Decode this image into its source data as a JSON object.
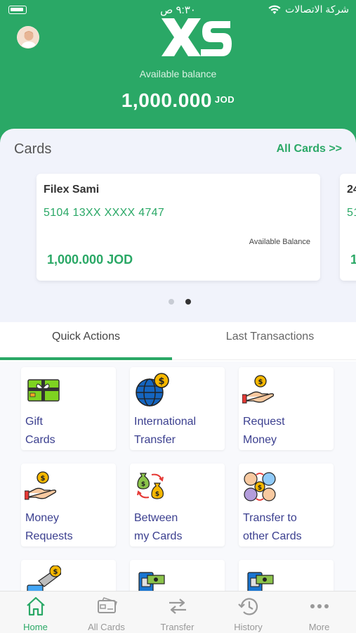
{
  "status_bar": {
    "time": "٩:٣٠ ص",
    "carrier": "شركة الاتصالات"
  },
  "header": {
    "logo_text": "XS",
    "available_label": "Available balance",
    "balance": "1,000.000",
    "currency": "JOD"
  },
  "cards": {
    "title": "Cards",
    "all_cards_link": "All Cards >>",
    "items": [
      {
        "holder": "Filex Sami",
        "number": "5104 13XX XXXX 4747",
        "available_label": "Available Balance",
        "amount": "1,000.000 JOD"
      },
      {
        "holder": "24",
        "number": "51",
        "available_label": "",
        "amount": "1"
      }
    ],
    "pager_active_index": 1
  },
  "tabs": [
    {
      "label": "Quick Actions",
      "active": true
    },
    {
      "label": "Last Transactions",
      "active": false
    }
  ],
  "quick_actions": [
    {
      "label": "Gift\nCards",
      "icon": "gift-card-icon"
    },
    {
      "label": "International\nTransfer",
      "icon": "globe-dollar-icon"
    },
    {
      "label": "Request\nMoney",
      "icon": "hand-coin-icon"
    },
    {
      "label": "Money\nRequests",
      "icon": "hand-coin-icon"
    },
    {
      "label": "Between\nmy Cards",
      "icon": "money-bag-exchange-icon"
    },
    {
      "label": "Transfer to\nother Cards",
      "icon": "people-exchange-icon"
    },
    {
      "label": "",
      "icon": "card-payment-icon"
    },
    {
      "label": "",
      "icon": "atm-icon"
    },
    {
      "label": "",
      "icon": "atm-icon"
    }
  ],
  "bottom_nav": [
    {
      "label": "Home",
      "icon": "home-icon",
      "active": true
    },
    {
      "label": "All Cards",
      "icon": "credit-card-icon",
      "active": false
    },
    {
      "label": "Transfer",
      "icon": "transfer-arrows-icon",
      "active": false
    },
    {
      "label": "History",
      "icon": "history-clock-icon",
      "active": false
    },
    {
      "label": "More",
      "icon": "more-dots-icon",
      "active": false
    }
  ],
  "colors": {
    "brand_green": "#2aa866",
    "action_text": "#3b3f8f",
    "cards_bg": "#f1f3fb"
  }
}
